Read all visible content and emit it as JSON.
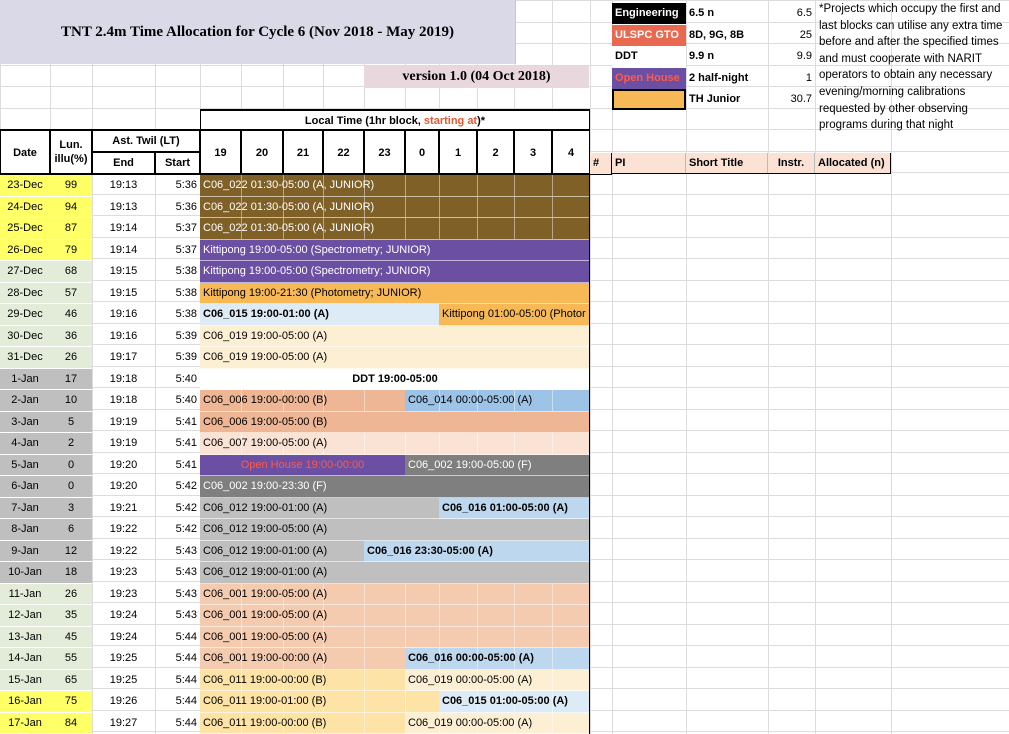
{
  "title": "TNT 2.4m Time Allocation for Cycle 6 (Nov 2018 - May 2019)",
  "version": "version 1.0 (04 Oct 2018)",
  "legend": [
    {
      "label": "Engineering",
      "detail": "6.5 n",
      "value": "6.5",
      "color": "#000000",
      "text_color": "#ffffff"
    },
    {
      "label": "ULSPC GTO",
      "detail": "8D, 9G, 8B",
      "value": "25",
      "color": "#e8694f",
      "text_color": "#ffffff"
    },
    {
      "label": "DDT",
      "detail": "9.9 n",
      "value": "9.9",
      "color": "#ffffff",
      "text_color": "#000000"
    },
    {
      "label": "Open House",
      "detail": "2 half-night",
      "value": "1",
      "color": "#6b4fa3",
      "text_color": "#ff5a4a"
    },
    {
      "label": "",
      "detail": "TH Junior",
      "value": "30.7",
      "color": "#f6b955",
      "text_color": "#000000"
    }
  ],
  "note": "*Projects which occupy the first and last blocks can utilise any extra time before and after the specified times and must cooperate with NARIT operators to obtain any necessary evening/morning calibrations requested by other observing programs during that night",
  "headers": {
    "local_time_prefix": "Local Time (1hr block, ",
    "local_time_highlight": "starting at",
    "local_time_suffix": ")*",
    "date": "Date",
    "lun": "Lun.",
    "illu": "illu(%)",
    "twil": "Ast. Twil (LT)",
    "end": "End",
    "start": "Start",
    "hours": [
      "19",
      "20",
      "21",
      "22",
      "23",
      "0",
      "1",
      "2",
      "3",
      "4"
    ],
    "right": [
      "#",
      "PI",
      "Short Title",
      "Instr.",
      "Allocated (n)"
    ]
  },
  "rows": [
    {
      "date": "23-Dec",
      "lun": "99",
      "end": "19:13",
      "start": "5:36",
      "lun_color": "#ffff66",
      "date_color": "#ffff66"
    },
    {
      "date": "24-Dec",
      "lun": "94",
      "end": "19:13",
      "start": "5:36",
      "lun_color": "#ffff66",
      "date_color": "#ffff66"
    },
    {
      "date": "25-Dec",
      "lun": "87",
      "end": "19:14",
      "start": "5:37",
      "lun_color": "#ffff66",
      "date_color": "#ffff66"
    },
    {
      "date": "26-Dec",
      "lun": "79",
      "end": "19:14",
      "start": "5:37",
      "lun_color": "#ffff66",
      "date_color": "#ffff66"
    },
    {
      "date": "27-Dec",
      "lun": "68",
      "end": "19:15",
      "start": "5:38",
      "lun_color": "#e3ecd9",
      "date_color": "#e3ecd9"
    },
    {
      "date": "28-Dec",
      "lun": "57",
      "end": "19:15",
      "start": "5:38",
      "lun_color": "#e3ecd9",
      "date_color": "#e3ecd9"
    },
    {
      "date": "29-Dec",
      "lun": "46",
      "end": "19:16",
      "start": "5:38",
      "lun_color": "#e3ecd9",
      "date_color": "#e3ecd9"
    },
    {
      "date": "30-Dec",
      "lun": "36",
      "end": "19:16",
      "start": "5:39",
      "lun_color": "#e3ecd9",
      "date_color": "#e3ecd9"
    },
    {
      "date": "31-Dec",
      "lun": "26",
      "end": "19:17",
      "start": "5:39",
      "lun_color": "#e3ecd9",
      "date_color": "#e3ecd9"
    },
    {
      "date": "1-Jan",
      "lun": "17",
      "end": "19:18",
      "start": "5:40",
      "lun_color": "#bfbfbf",
      "date_color": "#bfbfbf"
    },
    {
      "date": "2-Jan",
      "lun": "10",
      "end": "19:18",
      "start": "5:40",
      "lun_color": "#bfbfbf",
      "date_color": "#bfbfbf"
    },
    {
      "date": "3-Jan",
      "lun": "5",
      "end": "19:19",
      "start": "5:41",
      "lun_color": "#bfbfbf",
      "date_color": "#bfbfbf"
    },
    {
      "date": "4-Jan",
      "lun": "2",
      "end": "19:19",
      "start": "5:41",
      "lun_color": "#bfbfbf",
      "date_color": "#bfbfbf"
    },
    {
      "date": "5-Jan",
      "lun": "0",
      "end": "19:20",
      "start": "5:41",
      "lun_color": "#bfbfbf",
      "date_color": "#bfbfbf"
    },
    {
      "date": "6-Jan",
      "lun": "0",
      "end": "19:20",
      "start": "5:42",
      "lun_color": "#bfbfbf",
      "date_color": "#bfbfbf"
    },
    {
      "date": "7-Jan",
      "lun": "3",
      "end": "19:21",
      "start": "5:42",
      "lun_color": "#bfbfbf",
      "date_color": "#bfbfbf"
    },
    {
      "date": "8-Jan",
      "lun": "6",
      "end": "19:22",
      "start": "5:42",
      "lun_color": "#bfbfbf",
      "date_color": "#bfbfbf"
    },
    {
      "date": "9-Jan",
      "lun": "12",
      "end": "19:22",
      "start": "5:43",
      "lun_color": "#bfbfbf",
      "date_color": "#bfbfbf"
    },
    {
      "date": "10-Jan",
      "lun": "18",
      "end": "19:23",
      "start": "5:43",
      "lun_color": "#bfbfbf",
      "date_color": "#bfbfbf"
    },
    {
      "date": "11-Jan",
      "lun": "26",
      "end": "19:23",
      "start": "5:43",
      "lun_color": "#e3ecd9",
      "date_color": "#e3ecd9"
    },
    {
      "date": "12-Jan",
      "lun": "35",
      "end": "19:24",
      "start": "5:43",
      "lun_color": "#e3ecd9",
      "date_color": "#e3ecd9"
    },
    {
      "date": "13-Jan",
      "lun": "45",
      "end": "19:24",
      "start": "5:44",
      "lun_color": "#e3ecd9",
      "date_color": "#e3ecd9"
    },
    {
      "date": "14-Jan",
      "lun": "55",
      "end": "19:25",
      "start": "5:44",
      "lun_color": "#e3ecd9",
      "date_color": "#e3ecd9"
    },
    {
      "date": "15-Jan",
      "lun": "65",
      "end": "19:25",
      "start": "5:44",
      "lun_color": "#e3ecd9",
      "date_color": "#e3ecd9"
    },
    {
      "date": "16-Jan",
      "lun": "75",
      "end": "19:26",
      "start": "5:44",
      "lun_color": "#ffff66",
      "date_color": "#ffff66"
    },
    {
      "date": "17-Jan",
      "lun": "84",
      "end": "19:27",
      "start": "5:44",
      "lun_color": "#ffff66",
      "date_color": "#ffff66"
    }
  ],
  "allocations": [
    {
      "row": 0,
      "from": 0,
      "to": 10,
      "label": "C06_022 01:30-05:00 (A, JUNIOR)",
      "color": "#7f6027",
      "text": "#ffffff",
      "bold": false,
      "lines": true
    },
    {
      "row": 1,
      "from": 0,
      "to": 10,
      "label": "C06_022 01:30-05:00 (A, JUNIOR)",
      "color": "#7f6027",
      "text": "#ffffff",
      "bold": false,
      "lines": true
    },
    {
      "row": 2,
      "from": 0,
      "to": 10,
      "label": "C06_022 01:30-05:00 (A, JUNIOR)",
      "color": "#7f6027",
      "text": "#ffffff",
      "bold": false,
      "lines": true
    },
    {
      "row": 3,
      "from": 0,
      "to": 10,
      "label": "Kittipong 19:00-05:00 (Spectrometry; JUNIOR)",
      "color": "#6b4fa3",
      "text": "#ffffff",
      "bold": false,
      "lines": false
    },
    {
      "row": 4,
      "from": 0,
      "to": 10,
      "label": "Kittipong 19:00-05:00 (Spectrometry; JUNIOR)",
      "color": "#6b4fa3",
      "text": "#ffffff",
      "bold": false,
      "lines": false
    },
    {
      "row": 5,
      "from": 0,
      "to": 10,
      "label": "Kittipong 19:00-21:30 (Photometry; JUNIOR)",
      "color": "#f6b955",
      "text": "#000000",
      "bold": false,
      "lines": false
    },
    {
      "row": 6,
      "from": 0,
      "to": 6,
      "label": "C06_015 19:00-01:00 (A)",
      "color": "#ddebf7",
      "text": "#000000",
      "bold": true,
      "lines": false
    },
    {
      "row": 6,
      "from": 6,
      "to": 10,
      "label": "Kittipong 01:00-05:00 (Photor",
      "color": "#f6b955",
      "text": "#000000",
      "bold": false,
      "lines": false
    },
    {
      "row": 7,
      "from": 0,
      "to": 10,
      "label": "C06_019 19:00-05:00 (A)",
      "color": "#fdefd4",
      "text": "#000000",
      "bold": false,
      "lines": false
    },
    {
      "row": 8,
      "from": 0,
      "to": 10,
      "label": "C06_019 19:00-05:00 (A)",
      "color": "#fdefd4",
      "text": "#000000",
      "bold": false,
      "lines": false
    },
    {
      "row": 9,
      "from": 0,
      "to": 10,
      "label": "DDT 19:00-05:00",
      "color": "#ffffff",
      "text": "#000000",
      "bold": true,
      "lines": false,
      "center": true
    },
    {
      "row": 10,
      "from": 0,
      "to": 5,
      "label": "C06_006 19:00-00:00 (B)",
      "color": "#eeb694",
      "text": "#000000",
      "bold": false,
      "lines": true
    },
    {
      "row": 10,
      "from": 5,
      "to": 10,
      "label": "C06_014 00:00-05:00 (A)",
      "color": "#9dc3e6",
      "text": "#000000",
      "bold": false,
      "lines": true
    },
    {
      "row": 11,
      "from": 0,
      "to": 10,
      "label": "C06_006 19:00-05:00 (B)",
      "color": "#eeb694",
      "text": "#000000",
      "bold": false,
      "lines": false
    },
    {
      "row": 12,
      "from": 0,
      "to": 10,
      "label": "C06_007 19:00-05:00 (A)",
      "color": "#fae3d5",
      "text": "#000000",
      "bold": false,
      "lines": true
    },
    {
      "row": 13,
      "from": 0,
      "to": 5,
      "label": "Open House 19:00-00:00",
      "color": "#6b4fa3",
      "text": "#ff5a4a",
      "bold": false,
      "lines": false,
      "center": true
    },
    {
      "row": 13,
      "from": 5,
      "to": 10,
      "label": "C06_002 19:00-05:00 (F)",
      "color": "#7f7f7f",
      "text": "#ffffff",
      "bold": false,
      "lines": false
    },
    {
      "row": 14,
      "from": 0,
      "to": 10,
      "label": "C06_002 19:00-23:30 (F)",
      "color": "#7f7f7f",
      "text": "#ffffff",
      "bold": false,
      "lines": false
    },
    {
      "row": 15,
      "from": 0,
      "to": 6,
      "label": "C06_012 19:00-01:00 (A)",
      "color": "#bfbfbf",
      "text": "#000000",
      "bold": false,
      "lines": false
    },
    {
      "row": 15,
      "from": 6,
      "to": 10,
      "label": "C06_016 01:00-05:00 (A)",
      "color": "#bdd7ee",
      "text": "#000000",
      "bold": true,
      "lines": false
    },
    {
      "row": 16,
      "from": 0,
      "to": 10,
      "label": "C06_012 19:00-05:00 (A)",
      "color": "#bfbfbf",
      "text": "#000000",
      "bold": false,
      "lines": false
    },
    {
      "row": 17,
      "from": 0,
      "to": 4,
      "label": "C06_012 19:00-01:00 (A)",
      "color": "#bfbfbf",
      "text": "#000000",
      "bold": false,
      "lines": false
    },
    {
      "row": 17,
      "from": 4,
      "to": 10,
      "label": "C06_016 23:30-05:00 (A)",
      "color": "#bdd7ee",
      "text": "#000000",
      "bold": true,
      "lines": false
    },
    {
      "row": 18,
      "from": 0,
      "to": 10,
      "label": "C06_012 19:00-01:00 (A)",
      "color": "#bfbfbf",
      "text": "#000000",
      "bold": false,
      "lines": false
    },
    {
      "row": 19,
      "from": 0,
      "to": 10,
      "label": "C06_001 19:00-05:00 (A)",
      "color": "#f5cbb0",
      "text": "#000000",
      "bold": false,
      "lines": true
    },
    {
      "row": 20,
      "from": 0,
      "to": 10,
      "label": "C06_001 19:00-05:00 (A)",
      "color": "#f5cbb0",
      "text": "#000000",
      "bold": false,
      "lines": true
    },
    {
      "row": 21,
      "from": 0,
      "to": 10,
      "label": "C06_001 19:00-05:00 (A)",
      "color": "#f5cbb0",
      "text": "#000000",
      "bold": false,
      "lines": true
    },
    {
      "row": 22,
      "from": 0,
      "to": 5,
      "label": "C06_001 19:00-00:00 (A)",
      "color": "#f5cbb0",
      "text": "#000000",
      "bold": false,
      "lines": true
    },
    {
      "row": 22,
      "from": 5,
      "to": 10,
      "label": "C06_016 00:00-05:00 (A)",
      "color": "#bdd7ee",
      "text": "#000000",
      "bold": true,
      "lines": true
    },
    {
      "row": 23,
      "from": 0,
      "to": 5,
      "label": "C06_011 19:00-00:00 (B)",
      "color": "#fde4a6",
      "text": "#000000",
      "bold": false,
      "lines": true
    },
    {
      "row": 23,
      "from": 5,
      "to": 10,
      "label": "C06_019 00:00-05:00 (A)",
      "color": "#fdefd4",
      "text": "#000000",
      "bold": false,
      "lines": true
    },
    {
      "row": 24,
      "from": 0,
      "to": 6,
      "label": "C06_011 19:00-01:00 (B)",
      "color": "#fde4a6",
      "text": "#000000",
      "bold": false,
      "lines": true
    },
    {
      "row": 24,
      "from": 6,
      "to": 10,
      "label": "C06_015 01:00-05:00 (A)",
      "color": "#ddebf7",
      "text": "#000000",
      "bold": true,
      "lines": true
    },
    {
      "row": 25,
      "from": 0,
      "to": 5,
      "label": "C06_011 19:00-00:00 (B)",
      "color": "#fde4a6",
      "text": "#000000",
      "bold": false,
      "lines": true
    },
    {
      "row": 25,
      "from": 5,
      "to": 10,
      "label": "C06_019 00:00-05:00 (A)",
      "color": "#fdefd4",
      "text": "#000000",
      "bold": false,
      "lines": true
    }
  ]
}
